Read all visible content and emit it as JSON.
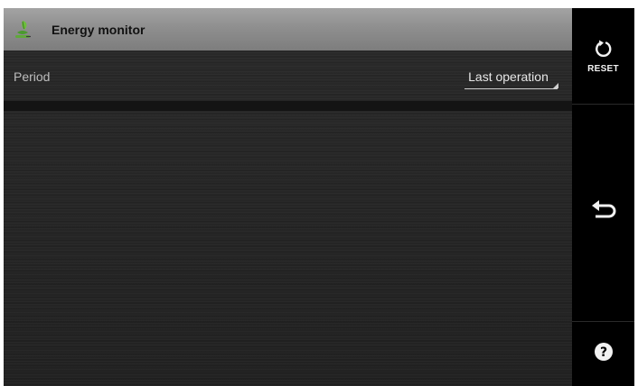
{
  "header": {
    "title": "Energy monitor",
    "icon": "energy-plug-leaf-icon"
  },
  "period": {
    "label": "Period",
    "selected": "Last operation"
  },
  "sidebar": {
    "reset_label": "RESET",
    "reset_icon": "reset-icon",
    "back_icon": "back-arrow-icon",
    "help_icon": "help-icon"
  },
  "colors": {
    "titlebar": "#999999",
    "background": "#262626",
    "sidebar": "#000000",
    "icon_green": "#5fa83a"
  }
}
